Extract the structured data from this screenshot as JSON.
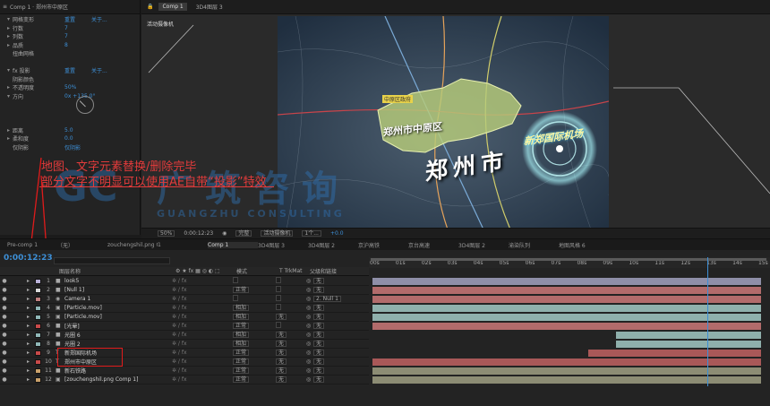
{
  "effects_panel": {
    "title_tab": "Comp 1 · 郑州市中原区",
    "rows": [
      {
        "twirl": "▾",
        "name": "网格变形",
        "value": "重置",
        "extra": "关于..."
      },
      {
        "twirl": "▸",
        "name": "行数",
        "value": "7"
      },
      {
        "twirl": "▸",
        "name": "列数",
        "value": "7"
      },
      {
        "twirl": "▸",
        "name": "品质",
        "value": "8"
      },
      {
        "twirl": "",
        "name": "扭曲网格",
        "value": ""
      },
      {
        "twirl": "",
        "name": "",
        "value": ""
      },
      {
        "twirl": "▾",
        "name": "fx  投影",
        "value": "重置",
        "extra": "关于..."
      },
      {
        "twirl": "",
        "name": "阴影颜色",
        "value": ""
      },
      {
        "twirl": "▸",
        "name": "不透明度",
        "value": "50%"
      },
      {
        "twirl": "▾",
        "name": "方向",
        "value": "0x +135.0°"
      },
      {
        "twirl": "",
        "name": "",
        "value": ""
      },
      {
        "twirl": "",
        "name": "",
        "value": ""
      },
      {
        "twirl": "",
        "name": "",
        "value": ""
      },
      {
        "twirl": "▸",
        "name": "距离",
        "value": "5.0"
      },
      {
        "twirl": "▸",
        "name": "柔和度",
        "value": "0.0"
      },
      {
        "twirl": "",
        "name": "仅阴影",
        "value": "仅阴影"
      }
    ]
  },
  "viewer": {
    "tabs": [
      "Comp 1",
      "3D4图层 3"
    ],
    "camera_label": "活动摄像机",
    "map_labels": {
      "district": "郑州市中原区",
      "city": "郑州市",
      "airport": "新郑国际机场",
      "tag": "中原区政府"
    },
    "watermark": {
      "line1": "广筑咨询",
      "line2": "GUANGZHU CONSULTING"
    },
    "bottom_bar": [
      "50%",
      "0:00:12:23",
      "完整",
      "活动摄像机",
      "1个...",
      "+0.0"
    ]
  },
  "annotation": {
    "line1": "地图、文字元素替换/删除完毕",
    "line2": "部分文字不明显可以使用AE自带“投影”特效"
  },
  "timeline": {
    "tabs": [
      "Pre-comp 1",
      "（无）",
      "zouchengshil.png Comp 1",
      "1",
      "Comp 1",
      "3D4图层 3",
      "3D4图层 2",
      "京沪高铁",
      "京台高速",
      "3D4图层 2",
      "渝染队列",
      "地图风格 6"
    ],
    "active_tab": 4,
    "timecode": "0:00:12:23",
    "headers": {
      "name": "图层名称",
      "mode": "模式",
      "trkmat": "T TrkMat",
      "parent": "父级和链接"
    },
    "ruler_ticks": [
      "00s",
      "01s",
      "02s",
      "03s",
      "04s",
      "05s",
      "06s",
      "07s",
      "08s",
      "09s",
      "10s",
      "11s",
      "12s",
      "13s",
      "14s",
      "15s"
    ],
    "colors": {
      "playhead": "#3d8fd6",
      "highlight": "#e01b1b"
    },
    "layers": [
      {
        "num": "1",
        "type": "■",
        "name": "look5",
        "label": "#b8b0d6",
        "mode": "",
        "trk": "",
        "parent": "无",
        "bar_color": "#8f8fa8",
        "start": 0.0,
        "end": 1.0
      },
      {
        "num": "2",
        "type": "■",
        "name": "[Null 1]",
        "label": "#d8d8d8",
        "mode": "正常",
        "trk": "",
        "parent": "无",
        "bar_color": "#b26b6b",
        "start": 0.0,
        "end": 1.0
      },
      {
        "num": "3",
        "type": "◉",
        "name": "Camera 1",
        "label": "#c08080",
        "mode": "",
        "trk": "",
        "parent": "2. Null 1",
        "bar_color": "#b26b6b",
        "start": 0.0,
        "end": 1.0
      },
      {
        "num": "4",
        "type": "▣",
        "name": "[Particle.mov]",
        "label": "#90b8b8",
        "mode": "相加",
        "trk": "",
        "parent": "无",
        "bar_color": "#8fb0ac",
        "start": 0.0,
        "end": 1.0
      },
      {
        "num": "5",
        "type": "▣",
        "name": "[Particle.mov]",
        "label": "#90b8b8",
        "mode": "相加",
        "trk": "无",
        "parent": "无",
        "bar_color": "#8fb0ac",
        "start": 0.0,
        "end": 1.0
      },
      {
        "num": "6",
        "type": "■",
        "name": "[光晕]",
        "label": "#c84a4a",
        "mode": "正常",
        "trk": "",
        "parent": "无",
        "bar_color": "#b26b6b",
        "start": 0.0,
        "end": 1.0
      },
      {
        "num": "7",
        "type": "■",
        "name": "光圈 6",
        "label": "#90b8b8",
        "mode": "相加",
        "trk": "无",
        "parent": "无",
        "bar_color": "#8fb0ac",
        "start": 0.627,
        "end": 1.0
      },
      {
        "num": "8",
        "type": "■",
        "name": "光圈 2",
        "label": "#90b8b8",
        "mode": "相加",
        "trk": "无",
        "parent": "无",
        "bar_color": "#8fb0ac",
        "start": 0.627,
        "end": 1.0
      },
      {
        "num": "9",
        "type": "T",
        "name": "新郑国际机场",
        "label": "#c84a4a",
        "mode": "正常",
        "trk": "无",
        "parent": "无",
        "bar_color": "#a95858",
        "start": 0.555,
        "end": 1.0
      },
      {
        "num": "10",
        "type": "T",
        "name": "郑州市中原区",
        "label": "#c84a4a",
        "mode": "正常",
        "trk": "无",
        "parent": "无",
        "bar_color": "#a95858",
        "start": 0.0,
        "end": 1.0
      },
      {
        "num": "11",
        "type": "■",
        "name": "新石铁路",
        "label": "#c8a06a",
        "mode": "正常",
        "trk": "无",
        "parent": "无",
        "bar_color": "#8c8c74",
        "start": 0.0,
        "end": 1.0
      },
      {
        "num": "12",
        "type": "▣",
        "name": "[zouchengshil.png Comp 1]",
        "label": "#c8a06a",
        "mode": "正常",
        "trk": "无",
        "parent": "无",
        "bar_color": "#8c8c74",
        "start": 0.0,
        "end": 1.0
      }
    ]
  }
}
